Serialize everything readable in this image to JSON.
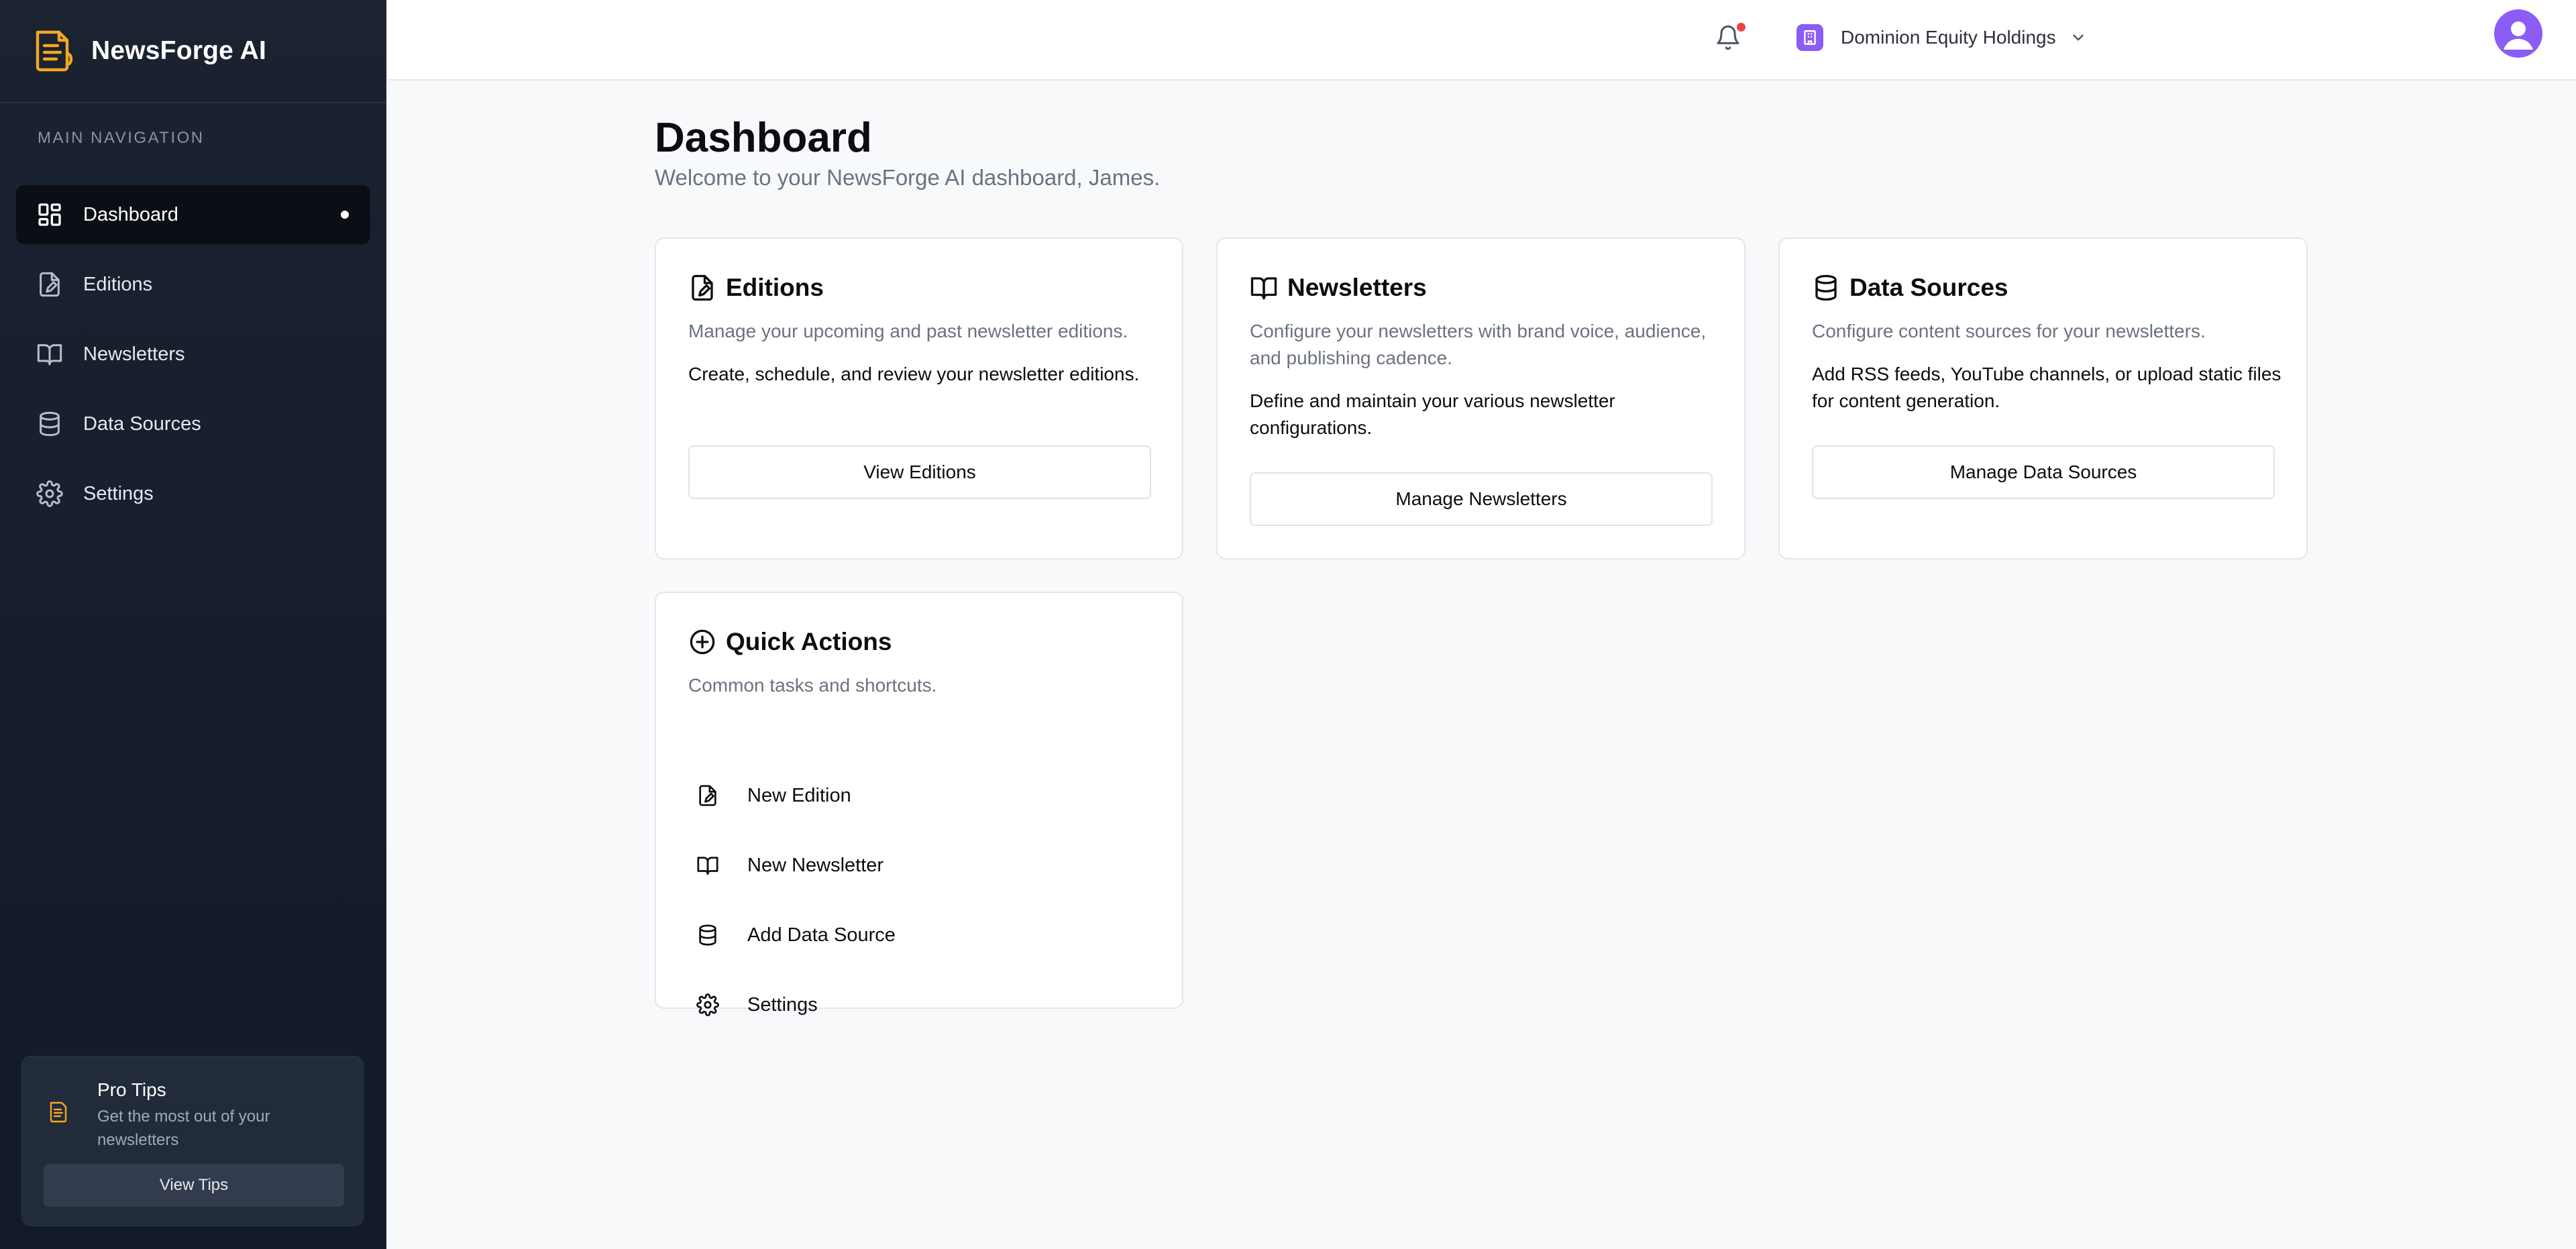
{
  "app": {
    "name": "NewsForge AI"
  },
  "sidebar": {
    "heading": "MAIN NAVIGATION",
    "items": [
      {
        "label": "Dashboard",
        "icon": "dashboard-icon",
        "active": true
      },
      {
        "label": "Editions",
        "icon": "edition-file-icon"
      },
      {
        "label": "Newsletters",
        "icon": "book-open-icon"
      },
      {
        "label": "Data Sources",
        "icon": "database-icon"
      },
      {
        "label": "Settings",
        "icon": "gear-icon"
      }
    ],
    "protips": {
      "title": "Pro Tips",
      "subtitle": "Get the most out of your newsletters",
      "button": "View Tips"
    }
  },
  "topbar": {
    "org": {
      "name": "Dominion Equity Holdings",
      "icon": "building-icon"
    },
    "notification": {
      "icon": "bell-icon",
      "unread": true
    },
    "accent": "#8b5cf6"
  },
  "main": {
    "title": "Dashboard",
    "subtitle": "Welcome to your NewsForge AI dashboard, James.",
    "cards": [
      {
        "title": "Editions",
        "description": "Manage your upcoming and past newsletter editions.",
        "body": "Create, schedule, and review your newsletter editions.",
        "button": "View Editions"
      },
      {
        "title": "Newsletters",
        "description": "Configure your newsletters with brand voice, audience, and publishing cadence.",
        "body": "Define and maintain your various newsletter configurations.",
        "button": "Manage Newsletters"
      },
      {
        "title": "Data Sources",
        "description": "Configure content sources for your newsletters.",
        "body": "Add RSS feeds, YouTube channels, or upload static files for content generation.",
        "button": "Manage Data Sources"
      }
    ],
    "quick_actions": {
      "title": "Quick Actions",
      "description": "Common tasks and shortcuts.",
      "items": [
        {
          "label": "New Edition",
          "icon": "edition-file-icon"
        },
        {
          "label": "New Newsletter",
          "icon": "book-open-icon"
        },
        {
          "label": "Add Data Source",
          "icon": "database-icon"
        },
        {
          "label": "Settings",
          "icon": "gear-icon"
        }
      ]
    }
  },
  "colors": {
    "sidebar_bg": "#161e2c",
    "active_nav_bg": "#0b0e14",
    "brand_logo": "#f5a623",
    "accent_purple": "#8b5cf6",
    "notification_dot": "#ef4444"
  }
}
